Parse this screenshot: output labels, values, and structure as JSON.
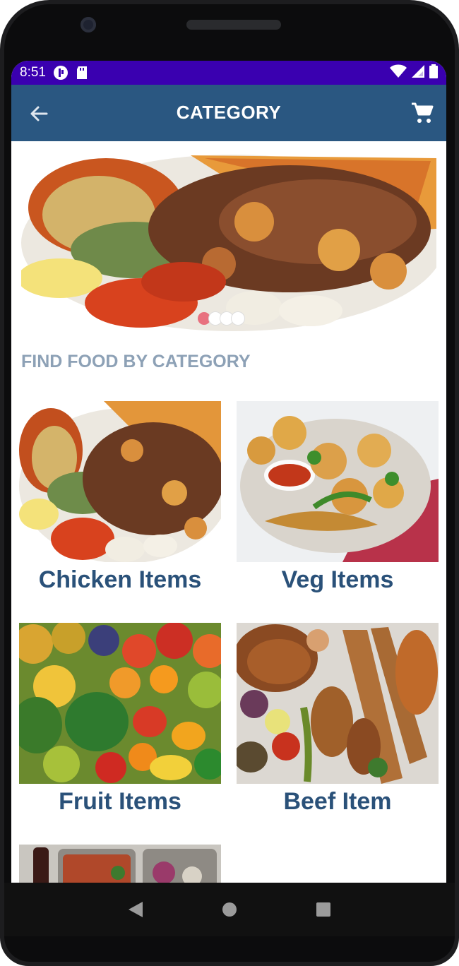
{
  "status": {
    "time": "8:51"
  },
  "appbar": {
    "title": "CATEGORY"
  },
  "banner": {
    "slide_count": 4,
    "active_slide": 1
  },
  "section": {
    "heading": "FIND FOOD BY CATEGORY"
  },
  "categories": [
    {
      "label": "Chicken Items"
    },
    {
      "label": "Veg Items"
    },
    {
      "label": "Fruit Items"
    },
    {
      "label": "Beef Item"
    }
  ],
  "colors": {
    "status_bar": "#3a00b0",
    "app_bar": "#2a5781",
    "heading": "#8da1b6",
    "category_label": "#2a5179",
    "active_dot": "#e8717f"
  }
}
